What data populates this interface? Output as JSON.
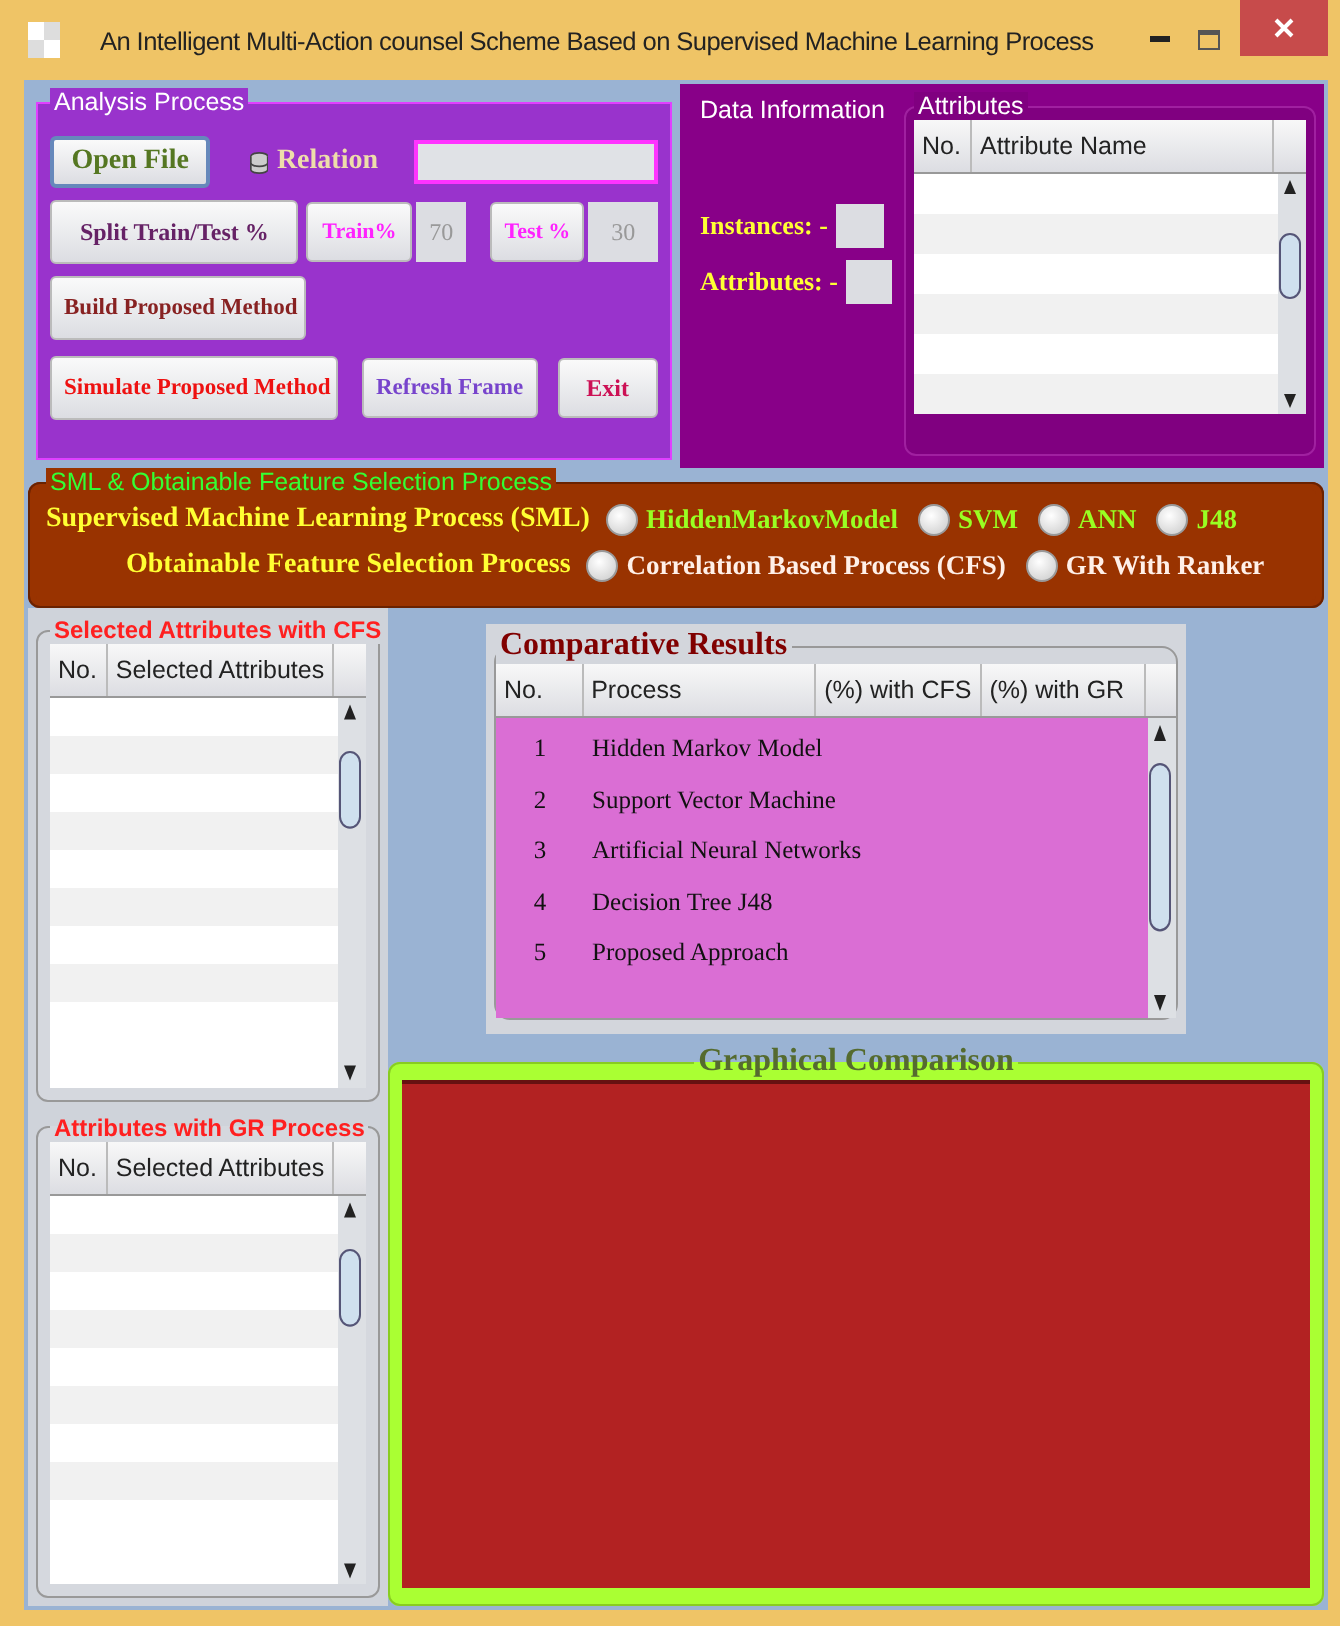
{
  "window": {
    "title": "An Intelligent Multi-Action counsel Scheme Based on Supervised Machine Learning Process"
  },
  "analysis_process": {
    "title": "Analysis Process",
    "open_file": "Open File",
    "relation_label": "Relation",
    "split": "Split Train/Test %",
    "train_label": "Train%",
    "train_value": "70",
    "test_label": "Test %",
    "test_value": "30",
    "build": "Build Proposed Method",
    "simulate": "Simulate Proposed Method",
    "refresh": "Refresh Frame",
    "exit": "Exit"
  },
  "data_information": {
    "title": "Data Information",
    "instances_label": "Instances: -",
    "attributes_label": "Attributes: -"
  },
  "attributes": {
    "title": "Attributes",
    "columns": [
      "No.",
      "Attribute Name"
    ]
  },
  "selection_panel": {
    "title": "SML & Obtainable Feature Selection Process",
    "rows": [
      {
        "kind": "sml",
        "label": "Supervised Machine Learning Process (SML)",
        "options": [
          {
            "label": "HiddenMarkovModel",
            "selected": false
          },
          {
            "label": "SVM",
            "selected": false
          },
          {
            "label": "ANN",
            "selected": false
          },
          {
            "label": "J48",
            "selected": false
          }
        ]
      },
      {
        "kind": "feature",
        "label": "Obtainable Feature Selection Process",
        "options": [
          {
            "label": "Correlation Based Process (CFS)",
            "selected": false
          },
          {
            "label": "GR With Ranker",
            "selected": false
          }
        ]
      }
    ]
  },
  "cfs_panel": {
    "title": "Selected Attributes with CFS",
    "columns": [
      "No.",
      "Selected Attributes"
    ]
  },
  "gr_panel": {
    "title": "Attributes with GR Process",
    "columns": [
      "No.",
      "Selected Attributes"
    ]
  },
  "comparative_results": {
    "title": "Comparative Results",
    "columns": [
      "No.",
      "Process",
      "(%) with CFS",
      "(%) with GR"
    ],
    "rows": [
      {
        "no": "1",
        "process": "Hidden Markov Model"
      },
      {
        "no": "2",
        "process": "Support Vector Machine"
      },
      {
        "no": "3",
        "process": "Artificial Neural Networks"
      },
      {
        "no": "4",
        "process": "Decision Tree J48"
      },
      {
        "no": "5",
        "process": "Proposed Approach"
      }
    ]
  },
  "graphical_comparison": {
    "title": "Graphical Comparison"
  }
}
